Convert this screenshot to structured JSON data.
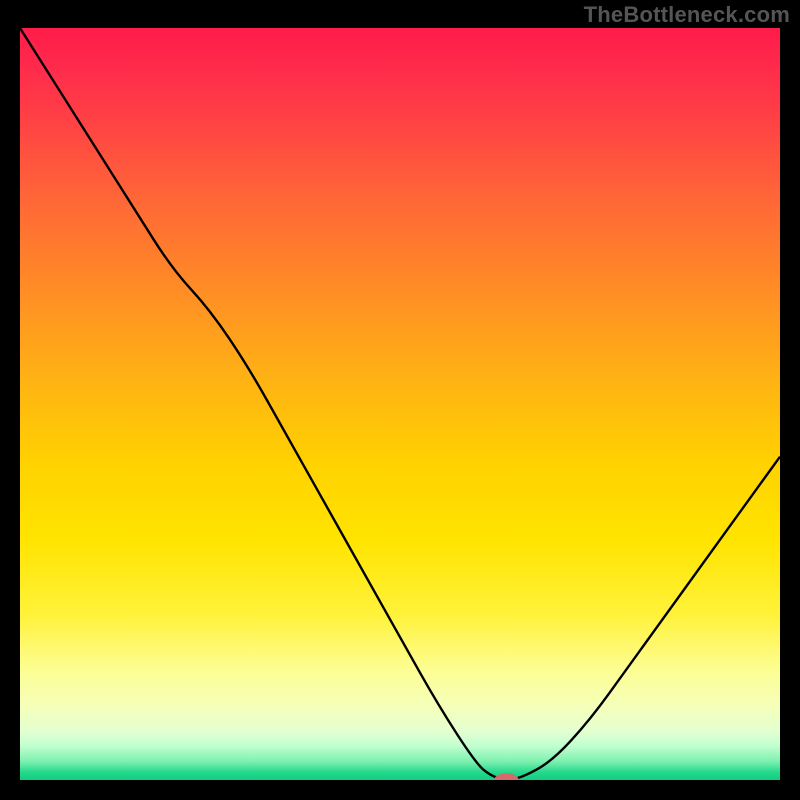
{
  "watermark": "TheBottleneck.com",
  "chart_data": {
    "type": "line",
    "title": "",
    "xlabel": "",
    "ylabel": "",
    "xlim": [
      0,
      100
    ],
    "ylim": [
      0,
      100
    ],
    "series": [
      {
        "name": "curve",
        "color": "#000000",
        "x": [
          0,
          5,
          10,
          15,
          20,
          25,
          30,
          35,
          40,
          45,
          50,
          55,
          60,
          62,
          64,
          66,
          70,
          75,
          80,
          85,
          90,
          95,
          100
        ],
        "y": [
          100,
          92,
          84,
          76,
          68,
          62.5,
          55,
          46,
          37,
          28,
          19,
          10,
          2.2,
          0.5,
          0,
          0.3,
          2.5,
          8,
          15,
          22,
          29,
          36,
          43
        ]
      }
    ],
    "marker": {
      "name": "marker",
      "color": "#d46a6a",
      "x": 64,
      "y": 0,
      "rx": 1.6,
      "ry": 0.9
    },
    "background": {
      "type": "vertical-gradient",
      "stops": [
        {
          "offset": 0.0,
          "color": "#ff1c4a"
        },
        {
          "offset": 0.05,
          "color": "#ff2a4b"
        },
        {
          "offset": 0.12,
          "color": "#ff4045"
        },
        {
          "offset": 0.22,
          "color": "#ff6438"
        },
        {
          "offset": 0.34,
          "color": "#ff8a26"
        },
        {
          "offset": 0.46,
          "color": "#ffb015"
        },
        {
          "offset": 0.58,
          "color": "#ffd200"
        },
        {
          "offset": 0.68,
          "color": "#ffe400"
        },
        {
          "offset": 0.78,
          "color": "#fff23a"
        },
        {
          "offset": 0.85,
          "color": "#fdfd8f"
        },
        {
          "offset": 0.9,
          "color": "#f6ffb8"
        },
        {
          "offset": 0.935,
          "color": "#e4ffd0"
        },
        {
          "offset": 0.955,
          "color": "#c0ffd0"
        },
        {
          "offset": 0.975,
          "color": "#7ef0b0"
        },
        {
          "offset": 0.99,
          "color": "#24d88c"
        },
        {
          "offset": 1.0,
          "color": "#12cd82"
        }
      ]
    }
  }
}
